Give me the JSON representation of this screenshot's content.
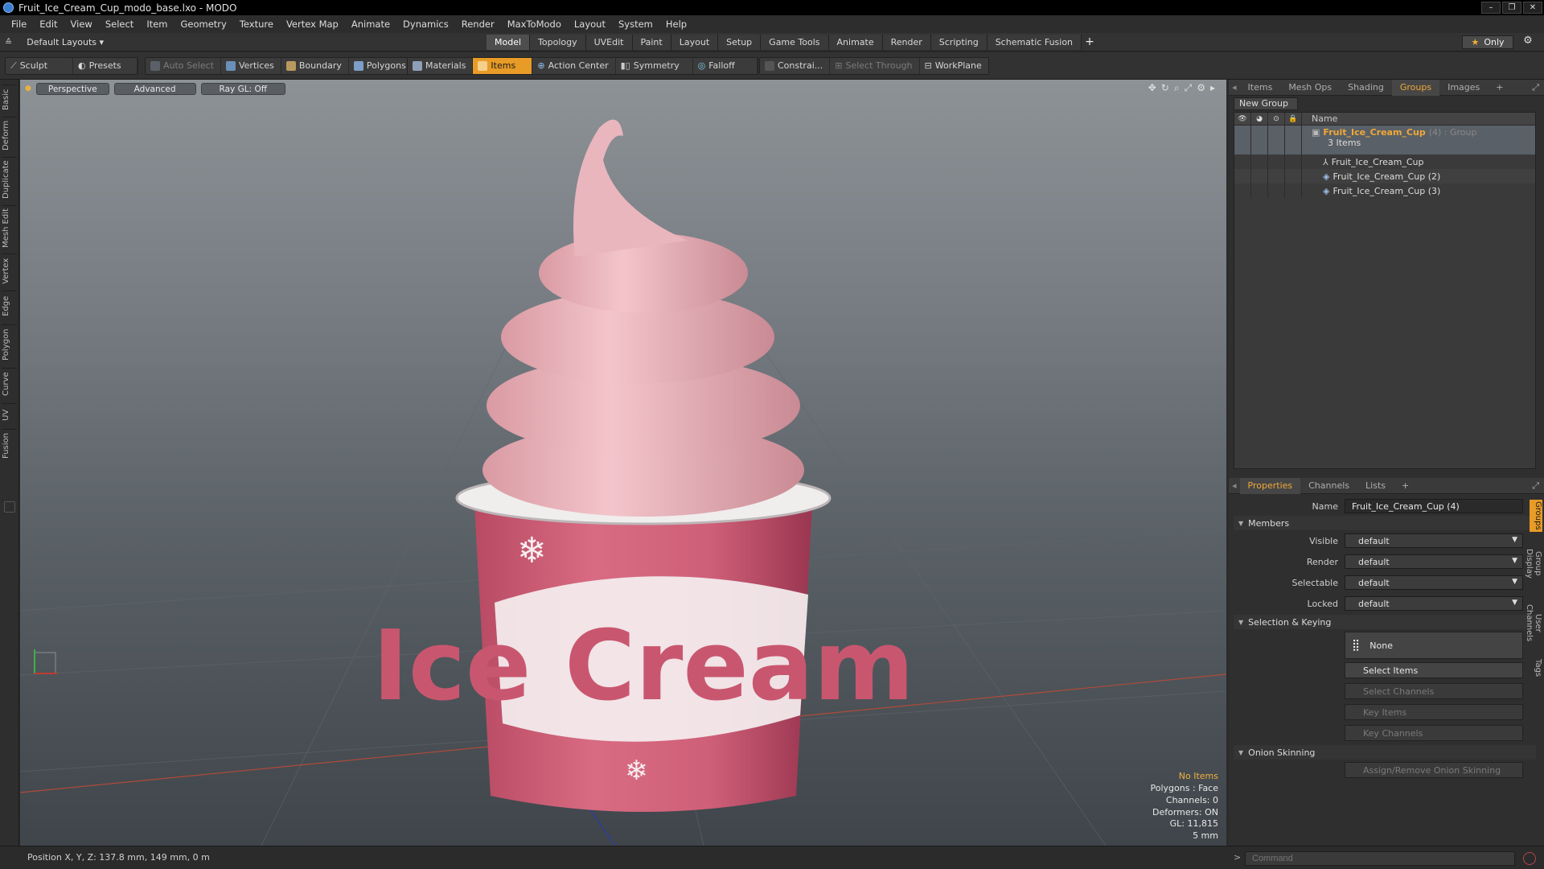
{
  "window": {
    "title": "Fruit_Ice_Cream_Cup_modo_base.lxo - MODO",
    "buttons": [
      "–",
      "❐",
      "✕"
    ]
  },
  "menu": [
    "File",
    "Edit",
    "View",
    "Select",
    "Item",
    "Geometry",
    "Texture",
    "Vertex Map",
    "Animate",
    "Dynamics",
    "Render",
    "MaxToModo",
    "Layout",
    "System",
    "Help"
  ],
  "layout": {
    "selector": "Default Layouts ▾",
    "tabs": [
      "Model",
      "Topology",
      "UVEdit",
      "Paint",
      "Layout",
      "Setup",
      "Game Tools",
      "Animate",
      "Render",
      "Scripting",
      "Schematic Fusion"
    ],
    "active_tab": "Model",
    "add": "+",
    "only": "Only"
  },
  "toolbar": {
    "sculpt": "Sculpt",
    "presets": "Presets",
    "auto_select": "Auto Select",
    "vertices": "Vertices",
    "boundary": "Boundary",
    "polygons": "Polygons",
    "materials": "Materials",
    "items": "Items",
    "action_center": "Action Center",
    "symmetry": "Symmetry",
    "falloff": "Falloff",
    "constrain": "Constrai...",
    "select_through": "Select Through",
    "workplane": "WorkPlane"
  },
  "left_tabs": [
    "Basic",
    "Deform",
    "Duplicate",
    "Mesh Edit",
    "Vertex",
    "Edge",
    "Polygon",
    "Curve",
    "UV",
    "Fusion"
  ],
  "viewport": {
    "view": "Perspective",
    "mode": "Advanced",
    "raygl": "Ray GL: Off",
    "info": {
      "selection": "No Items",
      "polygons": "Polygons : Face",
      "channels": "Channels: 0",
      "deformers": "Deformers: ON",
      "gl": "GL: 11,815",
      "scale": "5 mm"
    },
    "cup_text": "Ice Cream"
  },
  "top_panel": {
    "tabs": [
      "Items",
      "Mesh Ops",
      "Shading",
      "Groups",
      "Images"
    ],
    "active_tab": "Groups",
    "add": "+",
    "new_group": "New Group",
    "name_header": "Name",
    "group_name": "Fruit_Ice_Cream_Cup",
    "group_suffix": "(4) : Group",
    "group_count": "3 Items",
    "children": [
      "Fruit_Ice_Cream_Cup",
      "Fruit_Ice_Cream_Cup (2)",
      "Fruit_Ice_Cream_Cup (3)"
    ]
  },
  "properties": {
    "tabs": [
      "Properties",
      "Channels",
      "Lists"
    ],
    "active_tab": "Properties",
    "add": "+",
    "name_label": "Name",
    "name_value": "Fruit_Ice_Cream_Cup (4)",
    "members_section": "Members",
    "visible_label": "Visible",
    "visible_value": "default",
    "render_label": "Render",
    "render_value": "default",
    "selectable_label": "Selectable",
    "selectable_value": "default",
    "locked_label": "Locked",
    "locked_value": "default",
    "selection_section": "Selection & Keying",
    "none_btn": "None",
    "select_items": "Select Items",
    "select_channels": "Select Channels",
    "key_items": "Key Items",
    "key_channels": "Key Channels",
    "onion_section": "Onion Skinning",
    "onion_btn": "Assign/Remove Onion Skinning",
    "side_tabs": [
      "Groups",
      "Group Display",
      "User Channels",
      "Tags"
    ]
  },
  "status": {
    "position": "Position X, Y, Z:  137.8 mm, 149 mm, 0 m",
    "command_placeholder": "Command"
  }
}
